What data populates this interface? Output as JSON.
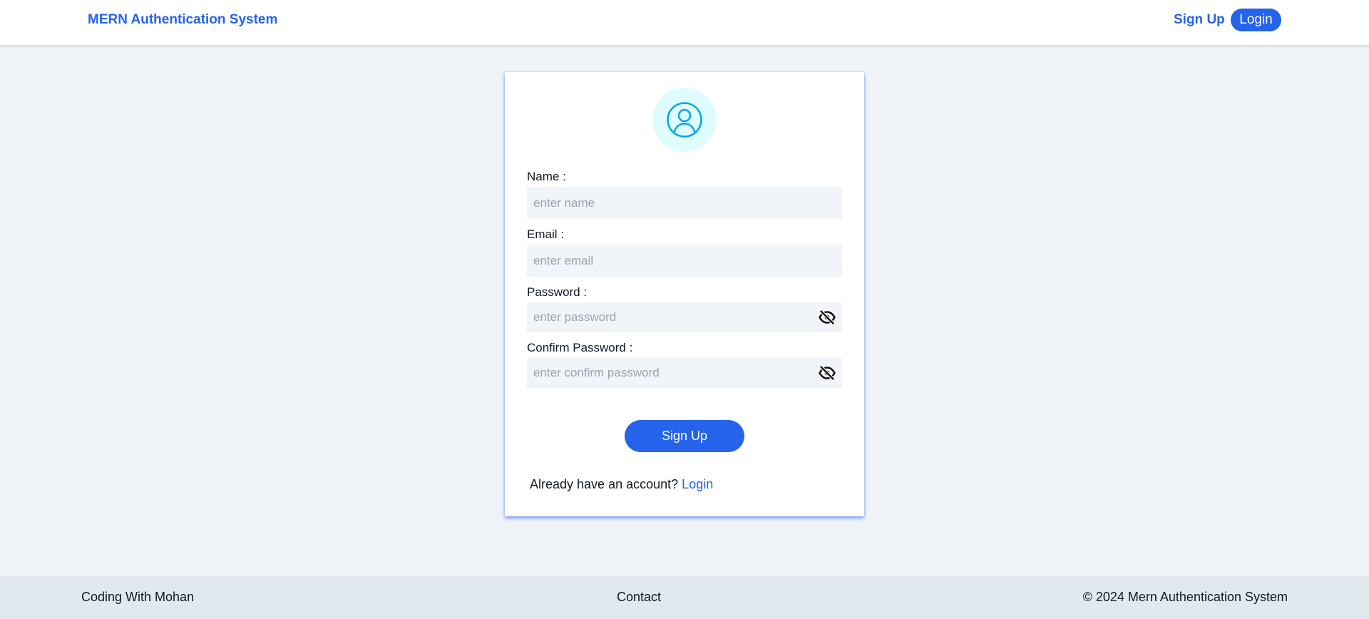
{
  "header": {
    "brand": "MERN Authentication System",
    "nav": {
      "signup_label": "Sign Up",
      "login_label": "Login"
    }
  },
  "form": {
    "avatar_icon": "user-circle-icon",
    "fields": {
      "name": {
        "label": "Name :",
        "placeholder": "enter name",
        "value": ""
      },
      "email": {
        "label": "Email :",
        "placeholder": "enter email",
        "value": ""
      },
      "password": {
        "label": "Password :",
        "placeholder": "enter password",
        "value": "",
        "toggle_icon": "eye-slash-icon"
      },
      "confirm_password": {
        "label": "Confirm Password :",
        "placeholder": "enter confirm password",
        "value": "",
        "toggle_icon": "eye-slash-icon"
      }
    },
    "submit_label": "Sign Up",
    "account_prompt": "Already have an account?",
    "login_link": "Login"
  },
  "footer": {
    "left": "Coding With Mohan",
    "center": "Contact",
    "right": "© 2024 Mern Authentication System"
  },
  "colors": {
    "primary": "#2563eb",
    "page_background": "#f0f4f9",
    "avatar_background": "#dffcff",
    "avatar_icon": "#0ea5e9",
    "footer_background": "#e2e8f0"
  }
}
